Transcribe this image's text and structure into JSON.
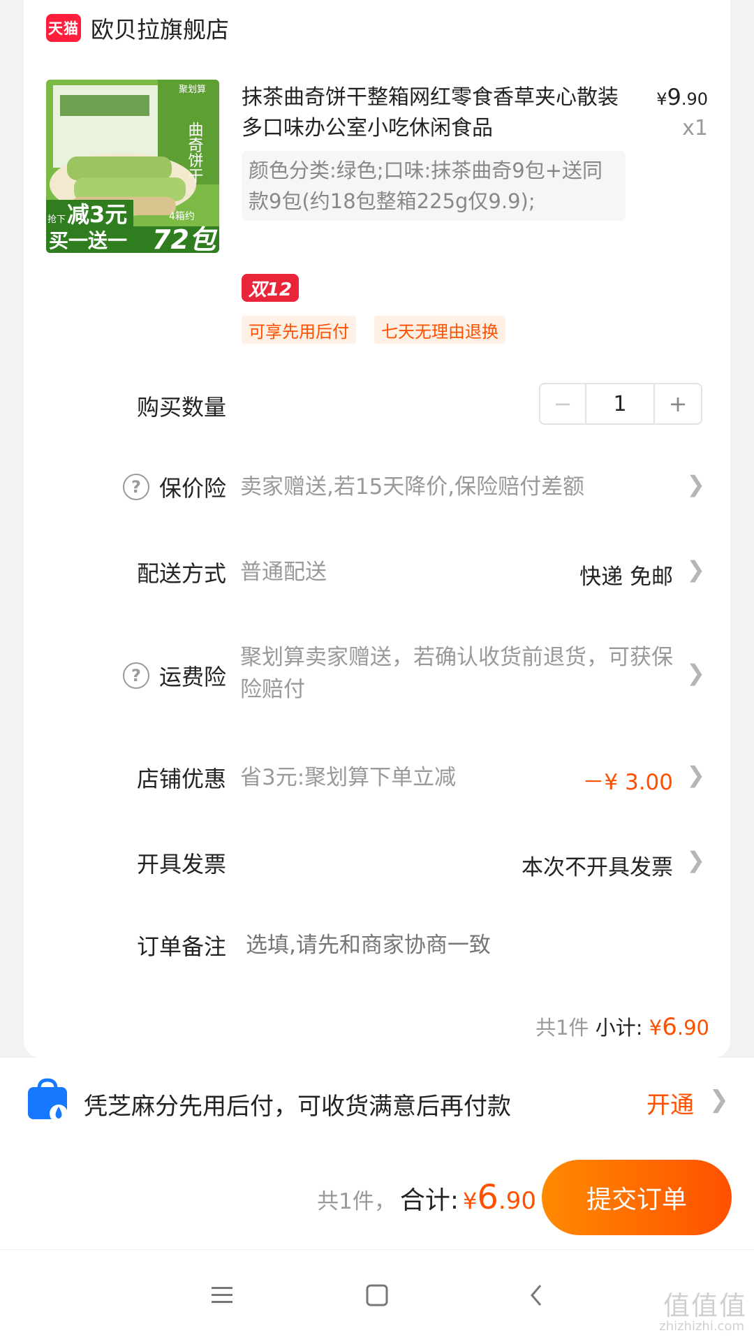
{
  "store": {
    "badge": "天猫",
    "name": "欧贝拉旗舰店"
  },
  "product": {
    "title": "抹茶曲奇饼干整箱网红零食香草夹心散装多口味办公室小吃休闲食品",
    "price": {
      "yen": "¥",
      "int": "9",
      "dec": ".90"
    },
    "quantity_label": "x1",
    "spec": "颜色分类:绿色;口味:抹茶曲奇9包+送同款9包(约18包整箱225g仅9.9);",
    "promo_badge": "双12",
    "tags": [
      "可享先用后付",
      "七天无理由退换"
    ],
    "image": {
      "top_badge": "聚划算",
      "side_text": "曲奇饼干",
      "promo_line1": "减3元",
      "promo_line1_prefix": "抢下",
      "promo_line2": "买一送一",
      "promo_count": "72包",
      "promo_count_prefix": "4箱约"
    }
  },
  "rows": {
    "quantity": {
      "label": "购买数量",
      "value": "1",
      "minus": "−",
      "plus": "+"
    },
    "price_protection": {
      "label": "保价险",
      "desc": "卖家赠送,若15天降价,保险赔付差额"
    },
    "delivery": {
      "label": "配送方式",
      "desc": "普通配送",
      "value": "快递 免邮"
    },
    "shipping_insurance": {
      "label": "运费险",
      "desc": "聚划算卖家赠送，若确认收货前退货，可获保险赔付"
    },
    "store_discount": {
      "label": "店铺优惠",
      "desc": "省3元:聚划算下单立减",
      "value": "－¥ 3.00"
    },
    "invoice": {
      "label": "开具发票",
      "value": "本次不开具发票"
    },
    "note": {
      "label": "订单备注",
      "placeholder": "选填,请先和商家协商一致"
    }
  },
  "subtotal": {
    "count": "共1件",
    "label": "小计:",
    "yen": "¥",
    "int": "6",
    "dec": ".90"
  },
  "pay_later": {
    "text": "凭芝麻分先用后付，可收货满意后再付款",
    "link": "开通"
  },
  "footer": {
    "count": "共1件，",
    "label": "合计:",
    "yen": "¥",
    "int": "6",
    "dec": ".90",
    "submit": "提交订单"
  },
  "watermark": {
    "text": "值值值",
    "sub": "zhizhizhi.com"
  },
  "colors": {
    "accent": "#ff5000",
    "tmall": "#ff1f3d",
    "d12": "#e9253a"
  }
}
